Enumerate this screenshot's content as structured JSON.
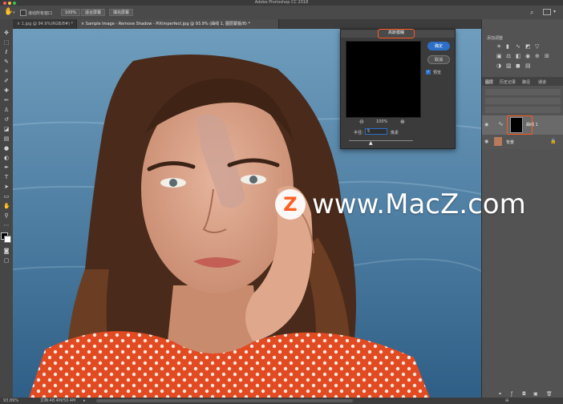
{
  "titlebar": {
    "title": "Adobe Photoshop CC 2018"
  },
  "optionsbar": {
    "scroll_all_label": "滚动所有窗口",
    "zoom_value": "100%",
    "fit_screen_label": "适合屏幕",
    "fill_screen_label": "填充屏幕"
  },
  "tabs": [
    {
      "label": "1.jpg @ 94.9%(RGB/8#) *"
    },
    {
      "label": "Sample Image - Remove Shadow - PiXimperfect.jpg @ 93.9% (曲线 1, 图层蒙版/8) *"
    }
  ],
  "status": {
    "zoom": "93.89%",
    "doc": "文档:48.4M/50.4M"
  },
  "dialog": {
    "title": "高斯模糊",
    "ok_label": "确定",
    "cancel_label": "取消",
    "preview_label": "预览",
    "zoom_value": "100%",
    "radius_label": "半径:",
    "radius_value": "5",
    "radius_unit": "像素"
  },
  "panels": {
    "adjust_title": "添加调整",
    "layers_tab": "图层",
    "history_tab": "历史记录",
    "paths_tab": "路径",
    "channels_tab": "通道",
    "layer_curves_name": "曲线 1",
    "layer_bg_name": "背景"
  },
  "watermark": {
    "text": "www.MacZ.com",
    "logo_letter": "Z"
  },
  "colors": {
    "accent_orange": "#ff5a1f",
    "dialog_button_blue": "#2d6ec8"
  }
}
